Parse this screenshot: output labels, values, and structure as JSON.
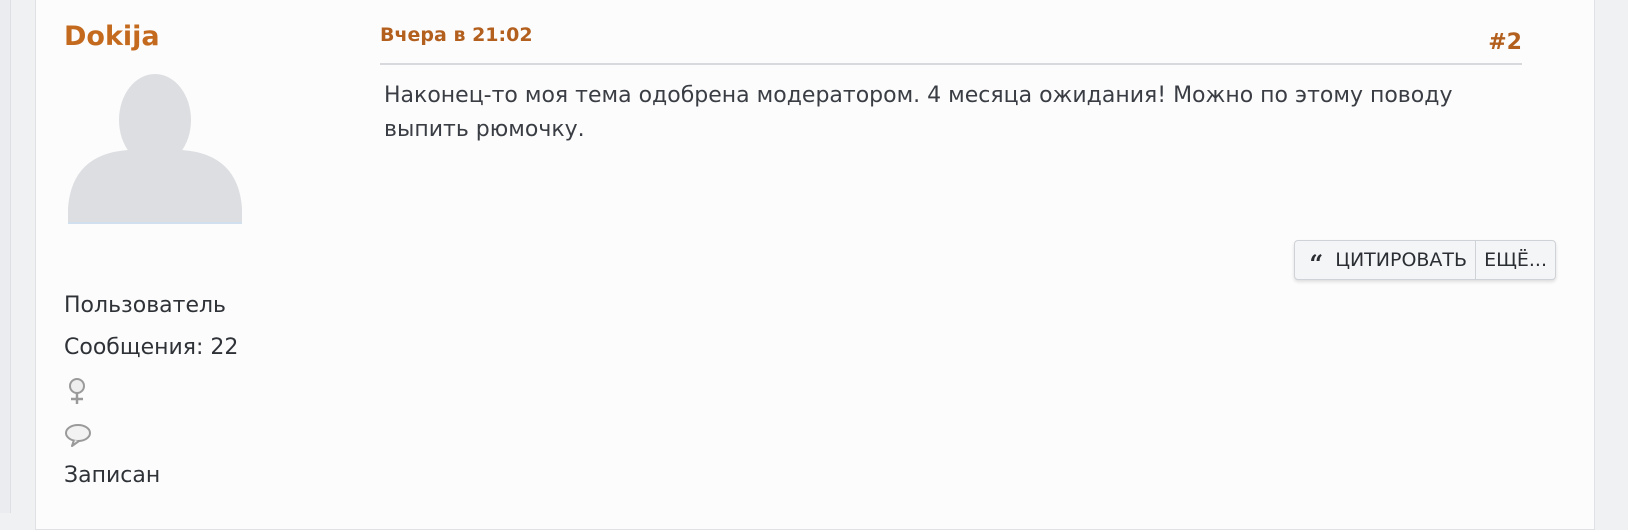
{
  "post": {
    "author": {
      "name": "Dokija",
      "role": "Пользователь",
      "posts_label": "Сообщения: 22",
      "registered_label": "Записан",
      "gender_icon": "female-symbol-icon",
      "pm_icon": "speech-bubble-icon"
    },
    "date": "Вчера в 21:02",
    "number": "#2",
    "body": "Наконец-то моя тема одобрена модератором. 4 месяца ожидания! Можно по этому поводу выпить рюмочку.",
    "actions": {
      "quote_icon": "quote-icon",
      "quote_label": "ЦИТИРОВАТЬ",
      "more_label": "ЕЩЁ..."
    }
  },
  "colors": {
    "accent": "#c46a1e",
    "text": "#3a3e44",
    "background": "#fcfcfc"
  }
}
